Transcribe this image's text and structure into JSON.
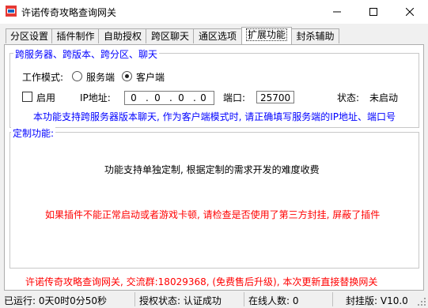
{
  "window": {
    "title": "许诺传奇攻略查询网关"
  },
  "tabs": [
    {
      "label": "分区设置",
      "active": false
    },
    {
      "label": "插件制作",
      "active": false
    },
    {
      "label": "自助授权",
      "active": false
    },
    {
      "label": "跨区聊天",
      "active": false
    },
    {
      "label": "通区选项",
      "active": false
    },
    {
      "label": "扩展功能",
      "active": true
    },
    {
      "label": "封杀辅助",
      "active": false
    }
  ],
  "cross_server": {
    "group_title": "跨服务器、跨版本、跨分区、聊天",
    "mode_label": "工作模式:",
    "mode_server": "服务端",
    "mode_client": "客户端",
    "selected_mode": "客户端",
    "enable_label": "启用",
    "enable_checked": false,
    "ip_label": "IP地址:",
    "ip": [
      "0",
      "0",
      "0",
      "0"
    ],
    "ip_separator": ".",
    "port_label": "端口:",
    "port_value": "25700",
    "status_label": "状态:",
    "status_value": "未启动",
    "hint": "本功能支持跨服务器版本聊天, 作为客户端模式时, 请正确填写服务端的IP地址、端口号"
  },
  "custom": {
    "group_title": "定制功能:",
    "description": "功能支持单独定制, 根据定制的需求开发的难度收费",
    "warning": "如果插件不能正常启动或者游戏卡顿, 请检查是否使用了第三方封挂, 屏蔽了插件"
  },
  "footer_note": "许诺传奇攻略查询网关, 交流群:18029368, (免费售后升级), 本次更新直接替换网关",
  "statusbar": {
    "uptime": "已运行: 0天0时0分50秒",
    "auth": "授权状态: 认证成功",
    "online": "在线人数: 0",
    "version": "封挂版: V10.0"
  },
  "colors": {
    "group_title": "#0000ff",
    "hint": "#0000ff",
    "warning": "#ff0000",
    "footer": "#ff0000"
  },
  "icons": {
    "app": "app-logo-icon",
    "minimize": "minimize-icon",
    "maximize": "maximize-icon",
    "close": "close-icon"
  }
}
